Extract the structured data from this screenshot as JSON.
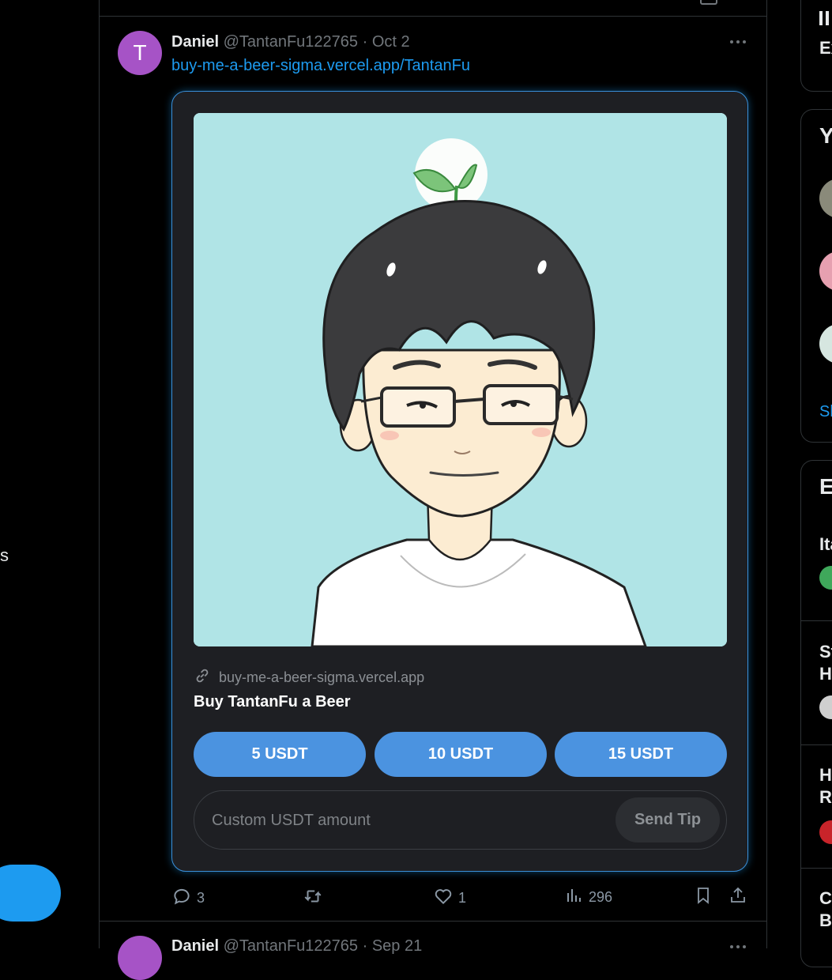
{
  "tweet": {
    "avatar_letter": "T",
    "name": "Daniel",
    "handle": "@TantanFu122765",
    "separator": "·",
    "date": "Oct 2",
    "link": "buy-me-a-beer-sigma.vercel.app/TantanFu",
    "card": {
      "domain": "buy-me-a-beer-sigma.vercel.app",
      "title": "Buy TantanFu a Beer",
      "buttons": [
        "5 USDT",
        "10 USDT",
        "15 USDT"
      ],
      "input_placeholder": "Custom USDT amount",
      "send_label": "Send Tip"
    },
    "actions": {
      "replies": "3",
      "likes": "1",
      "views": "296"
    }
  },
  "next_tweet": {
    "name": "Daniel",
    "handle": "@TantanFu122765",
    "separator": "·",
    "date": "Sep 21"
  },
  "left_sidebar": {
    "fragment": "s"
  },
  "right_sidebar": {
    "box1_text": "Ex",
    "box2_title": "Y",
    "box2_link": "Sl",
    "box3_title": "E",
    "trend1": "Ita",
    "trend2_line1": "St",
    "trend2_line2": "H",
    "trend3_line1": "H",
    "trend3_line2": "Re",
    "trend4_line1": "C",
    "trend4_line2": "Bl"
  },
  "colors": {
    "accent": "#1d9bf0",
    "tip_button": "#4b93e0",
    "avatar": "#a653c6",
    "image_bg": "#b0e4e6"
  }
}
